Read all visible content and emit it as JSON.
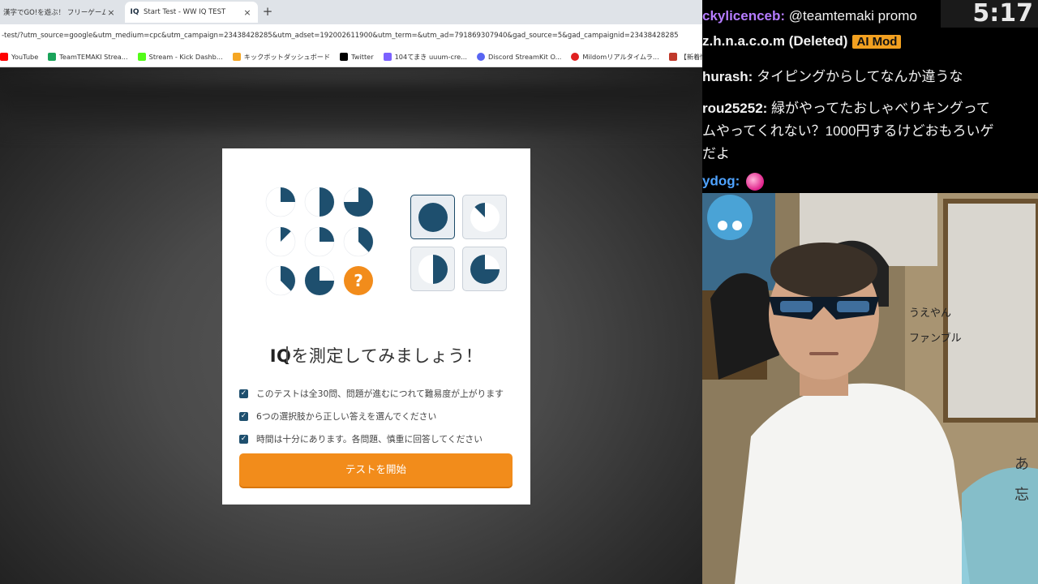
{
  "browser": {
    "tabs": [
      {
        "title": "漢字でGO!を遊ぶ！ フリーゲーム",
        "active": false,
        "close": "×"
      },
      {
        "title": "Start Test - WW IQ TEST",
        "favicon": "IQ",
        "active": true,
        "close": "×"
      }
    ],
    "new_tab": "+",
    "url": "-test/?utm_source=google&utm_medium=cpc&utm_campaign=23438428285&utm_adset=192002611900&utm_term=&utm_ad=791869307940&gad_source=5&gad_campaignid=23438428285",
    "bookmarks": [
      {
        "label": "YouTube",
        "color": "#ff0000"
      },
      {
        "label": "TeamTEMAKI Strea...",
        "color": "#1aa35a"
      },
      {
        "label": "Stream - Kick Dashb...",
        "color": "#53fc18"
      },
      {
        "label": "キックボットダッシュボード",
        "color": "#f5a623"
      },
      {
        "label": "Twitter",
        "color": "#000000"
      },
      {
        "label": "104てまき uuum-cre...",
        "color": "#7b61ff"
      },
      {
        "label": "Discord StreamKit O...",
        "color": "#5865f2"
      },
      {
        "label": "Mildomリアルタイムラ...",
        "color": "#e02020"
      },
      {
        "label": "【新着情報】外食チェ...",
        "color": "#c0392b"
      }
    ]
  },
  "quiz": {
    "heading_prefix": "IQ",
    "heading_rest": "を測定してみましょう！",
    "checks": [
      "このテストは全30問、問題が進むにつれて難易度が上がります",
      "6つの選択肢から正しい答えを選んでください",
      "時間は十分にあります。各問題、慎重に回答してください"
    ],
    "start_button": "テストを開始",
    "question_mark": "?",
    "colors": {
      "accent": "#f28c1b",
      "primary": "#1e4f6e"
    }
  },
  "chat": {
    "clock": "5:17",
    "lines": [
      {
        "user": "ckylicenceb:",
        "user_color": "#b57cff",
        "msg": " @teamtemaki promo"
      },
      {
        "user": "z.h.n.a.c.o.m (Deleted)",
        "user_color": "#f2f2f2",
        "msg": "",
        "badge": "AI Mod"
      },
      {
        "user": "hurash:",
        "user_color": "#f2f2f2",
        "msg": " タイピングからしてなんか違うな"
      },
      {
        "user": "rou25252:",
        "user_color": "#f2f2f2",
        "msg": " 緑がやってたおしゃべりキングって"
      },
      {
        "user": "",
        "user_color": "#f2f2f2",
        "msg": "ムやってくれない？1000円するけどおもろいゲ"
      },
      {
        "user": "",
        "user_color": "#f2f2f2",
        "msg": "だよ"
      },
      {
        "user": "ydog:",
        "user_color": "#4fa3ff",
        "msg": ""
      }
    ]
  },
  "webcam": {
    "wall_texts": [
      "うえやん",
      "ファンブル",
      "あ",
      "忘"
    ]
  }
}
